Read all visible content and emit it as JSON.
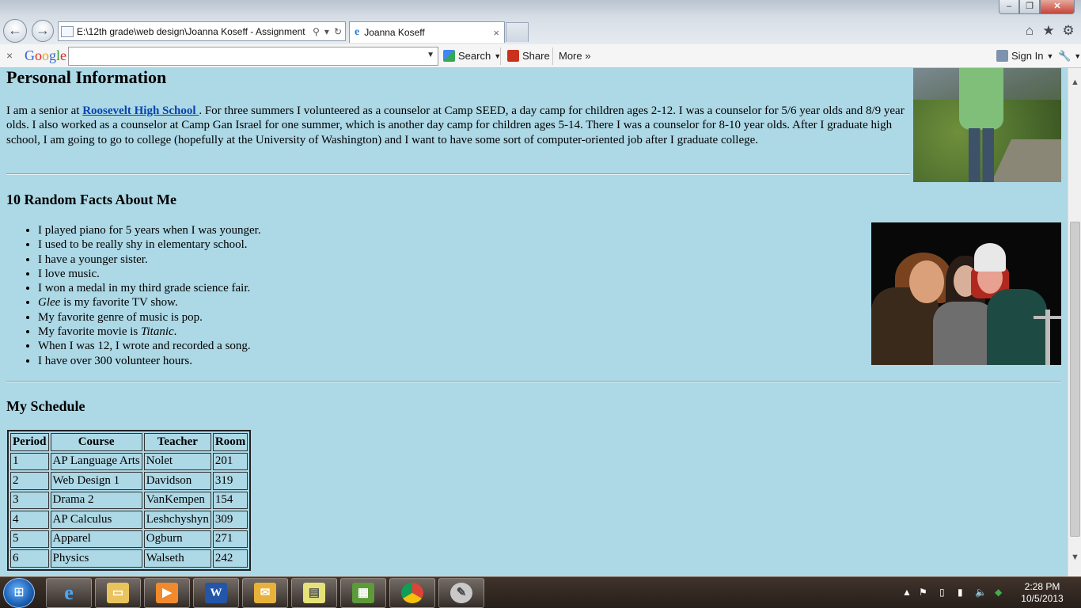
{
  "window": {
    "minimize": "–",
    "maximize": "❐",
    "close": "✕"
  },
  "browser": {
    "back_glyph": "←",
    "forward_glyph": "→",
    "address": "E:\\12th grade\\web design\\Joanna Koseff - Assignment",
    "tab_title": "Joanna Koseff",
    "tab_close": "×",
    "home_glyph": "⌂",
    "star_glyph": "★",
    "gear_glyph": "⚙"
  },
  "google_toolbar": {
    "close": "×",
    "logo": [
      "G",
      "o",
      "o",
      "g",
      "l",
      "e"
    ],
    "search_value": "",
    "search_label": "Search",
    "share_label": "Share",
    "more_label": "More »",
    "signin_label": "Sign In"
  },
  "page": {
    "heading_personal": "Personal Information",
    "bio_before": "I am a senior at ",
    "bio_link": "Roosevelt High School ",
    "bio_after": ". For three summers I volunteered as a counselor at Camp SEED, a day camp for children ages 2-12. I was a counselor for 5/6 year olds and 8/9 year olds. I also worked as a counselor at Camp Gan Israel for one summer, which is another day camp for children ages 5-14. There I was a counselor for 8-10 year olds. After I graduate high school, I am going to go to college (hopefully at the University of Washington) and I want to have some sort of computer-oriented job after I graduate college.",
    "heading_facts": "10 Random Facts About Me",
    "facts": [
      "I played piano for 5 years when I was younger.",
      "I used to be really shy in elementary school.",
      "I have a younger sister.",
      "I love music.",
      "I won a medal in my third grade science fair.",
      {
        "em": "Glee",
        "rest": " is my favorite TV show."
      },
      "My favorite genre of music is pop.",
      {
        "pre": "My favorite movie is ",
        "em": "Titanic",
        "rest": "."
      },
      "When I was 12, I wrote and recorded a song.",
      "I have over 300 volunteer hours."
    ],
    "heading_schedule": "My Schedule",
    "schedule_headers": [
      "Period",
      "Course",
      "Teacher",
      "Room"
    ],
    "schedule_rows": [
      [
        "1",
        "AP Language Arts",
        "Nolet",
        "201"
      ],
      [
        "2",
        "Web Design 1",
        "Davidson",
        "319"
      ],
      [
        "3",
        "Drama 2",
        "VanKempen",
        "154"
      ],
      [
        "4",
        "AP Calculus",
        "Leshchyshyn",
        "309"
      ],
      [
        "5",
        "Apparel",
        "Ogburn",
        "271"
      ],
      [
        "6",
        "Physics",
        "Walseth",
        "242"
      ]
    ]
  },
  "scrollbar": {
    "up": "▲",
    "down": "▼"
  },
  "taskbar": {
    "start_glyph": "⊞",
    "apps": [
      {
        "name": "ie",
        "glyph": "e"
      },
      {
        "name": "explorer",
        "glyph": "▭"
      },
      {
        "name": "media",
        "glyph": "▶"
      },
      {
        "name": "word",
        "glyph": "W"
      },
      {
        "name": "outlook",
        "glyph": "✉"
      },
      {
        "name": "notes",
        "glyph": "▤"
      },
      {
        "name": "project",
        "glyph": "▦"
      },
      {
        "name": "chrome",
        "glyph": ""
      },
      {
        "name": "paint",
        "glyph": "✎"
      }
    ],
    "clock_time": "2:28 PM",
    "clock_date": "10/5/2013",
    "tray_glyphs": [
      "▲",
      "⚑",
      "▯",
      "▮",
      "🔈",
      "◆"
    ]
  }
}
